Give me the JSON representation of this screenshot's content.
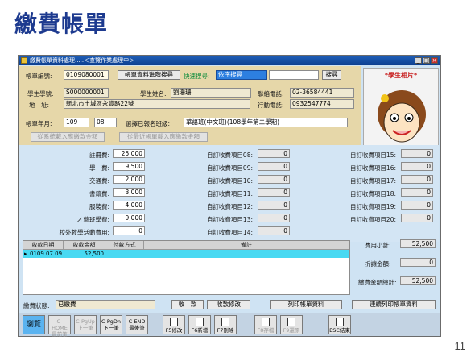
{
  "slide": {
    "title": "繳費帳單",
    "page_number": "11"
  },
  "window": {
    "title": "繳費帳單資料處理.....＜查覽作業處理中＞",
    "controls": [
      "_",
      "□",
      "×"
    ]
  },
  "header": {
    "bill_no_label": "帳單編號:",
    "bill_no_value": "0109080001",
    "advanced_search_btn": "帳單資料進階搜尋",
    "quick_search_label": "快速搜尋:",
    "quick_search_value": "依序搜尋",
    "search_btn": "搜尋",
    "student_id_label": "學生學號:",
    "student_id_value": "S000000001",
    "student_name_label": "學生姓名:",
    "student_name_value": "劉珊珊",
    "phone_label": "聯絡電話:",
    "phone_value": "02-36584441",
    "address_label": "地　址:",
    "address_value": "新北市土城區永豐路22號",
    "mobile_label": "行動電話:",
    "mobile_value": "0932547774",
    "bill_ym_label": "帳單年月:",
    "bill_year": "109",
    "bill_month": "08",
    "class_label": "選擇已報名班級:",
    "class_value": "華語班(中文班)(108學年第二學期)",
    "load_class_fee_btn": "從系統載入應繳款金額",
    "load_recent_fee_btn": "從最近帳單載入應繳款金額",
    "photo_label": "*學生相片*"
  },
  "fees": {
    "left": [
      {
        "label": "註冊費:",
        "value": "25,000"
      },
      {
        "label": "學　費:",
        "value": "9,500"
      },
      {
        "label": "交通費:",
        "value": "2,000"
      },
      {
        "label": "書籍費:",
        "value": "3,000"
      },
      {
        "label": "服裝費:",
        "value": "4,000"
      },
      {
        "label": "才藝班學費:",
        "value": "9,000"
      },
      {
        "label": "校外教學活動費用:",
        "value": "0"
      }
    ],
    "mid": [
      {
        "label": "自訂收費項目08:",
        "value": "0"
      },
      {
        "label": "自訂收費項目09:",
        "value": "0"
      },
      {
        "label": "自訂收費項目10:",
        "value": "0"
      },
      {
        "label": "自訂收費項目11:",
        "value": "0"
      },
      {
        "label": "自訂收費項目12:",
        "value": "0"
      },
      {
        "label": "自訂收費項目13:",
        "value": "0"
      },
      {
        "label": "自訂收費項目14:",
        "value": "0"
      }
    ],
    "right": [
      {
        "label": "自訂收費項目15:",
        "value": "0"
      },
      {
        "label": "自訂收費項目16:",
        "value": "0"
      },
      {
        "label": "自訂收費項目17:",
        "value": "0"
      },
      {
        "label": "自訂收費項目18:",
        "value": "0"
      },
      {
        "label": "自訂收費項目19:",
        "value": "0"
      },
      {
        "label": "自訂收費項目20:",
        "value": "0"
      }
    ]
  },
  "payments": {
    "headers": [
      "收款日期",
      "收款金額",
      "付款方式",
      "備註"
    ],
    "rows": [
      {
        "date": "0109.07.09",
        "amount": "52,500",
        "method": "",
        "note": ""
      }
    ]
  },
  "summary": {
    "subtotal_label": "費用小計:",
    "subtotal_value": "52,500",
    "discount_label": "折讓金額:",
    "discount_value": "0",
    "total_label": "繳費金額總計:",
    "total_value": "52,500"
  },
  "status": {
    "label": "繳費狀態:",
    "value": "已繳費",
    "collect_btn": "收　款",
    "modify_btn": "收款修改",
    "print_btn": "列印帳單資料",
    "print_cont_btn": "連續列印帳單資料"
  },
  "toolbar": [
    {
      "line1": "瀏覽",
      "line2": "",
      "state": "active"
    },
    {
      "line1": "C-HOME",
      "line2": "最前筆",
      "state": "disabled"
    },
    {
      "line1": "C-PgUp",
      "line2": "上一筆",
      "state": "disabled"
    },
    {
      "line1": "C-PgDn",
      "line2": "下一筆",
      "state": "normal"
    },
    {
      "line1": "C-END",
      "line2": "最後筆",
      "state": "normal"
    },
    {
      "line1": "F5修改",
      "line2": "",
      "state": "normal"
    },
    {
      "line1": "F6新增",
      "line2": "",
      "state": "normal"
    },
    {
      "line1": "F7刪除",
      "line2": "",
      "state": "normal"
    },
    {
      "line1": "F8存檔",
      "line2": "",
      "state": "disabled"
    },
    {
      "line1": "F9還原",
      "line2": "",
      "state": "disabled"
    },
    {
      "line1": "ESC結束",
      "line2": "",
      "state": "normal"
    }
  ],
  "colors": {
    "title_blue": "#1d3a8f",
    "header_bg": "#e6d7a9",
    "fee_bg": "#d3e5f4",
    "selected_row": "#48d9f2"
  }
}
